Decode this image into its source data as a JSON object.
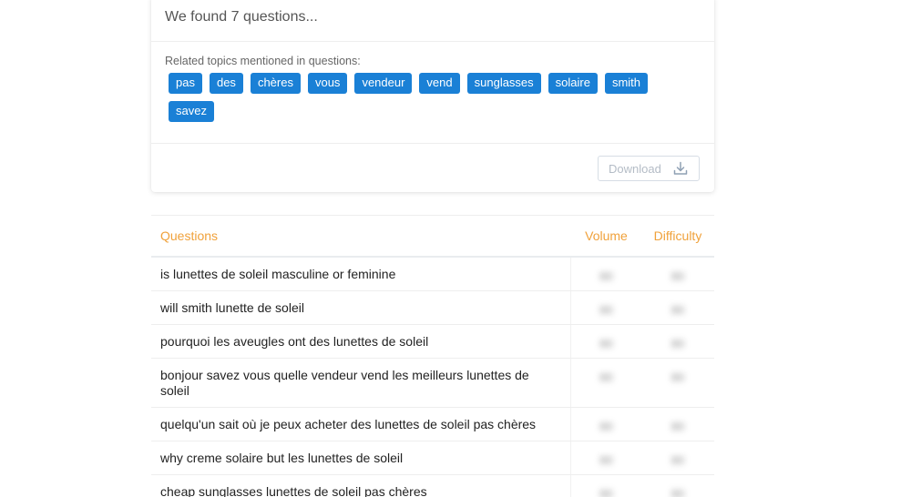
{
  "summary": {
    "found_text": "We found 7 questions..."
  },
  "topics": {
    "label": "Related topics mentioned in questions:",
    "tags": [
      "pas",
      "des",
      "chères",
      "vous",
      "vendeur",
      "vend",
      "sunglasses",
      "solaire",
      "smith",
      "savez"
    ]
  },
  "download": {
    "label": "Download",
    "icon": "download-icon"
  },
  "table": {
    "headers": {
      "question": "Questions",
      "volume": "Volume",
      "difficulty": "Difficulty"
    },
    "rows": [
      {
        "question": "is lunettes de soleil masculine or feminine",
        "volume": "80",
        "difficulty": "80"
      },
      {
        "question": "will smith lunette de soleil",
        "volume": "80",
        "difficulty": "80"
      },
      {
        "question": "pourquoi les aveugles ont des lunettes de soleil",
        "volume": "80",
        "difficulty": "80"
      },
      {
        "question": "bonjour savez vous quelle vendeur vend les meilleurs lunettes de soleil",
        "volume": "80",
        "difficulty": "80"
      },
      {
        "question": "quelqu'un sait où je peux acheter des lunettes de soleil pas chères",
        "volume": "80",
        "difficulty": "80"
      },
      {
        "question": "why creme solaire but les lunettes de soleil",
        "volume": "80",
        "difficulty": "80"
      },
      {
        "question": "cheap sunglasses lunettes de soleil pas chères",
        "volume": "80",
        "difficulty": "80"
      }
    ]
  },
  "colors": {
    "tag_bg": "#1a80d6",
    "header_text": "#f0a13a"
  }
}
